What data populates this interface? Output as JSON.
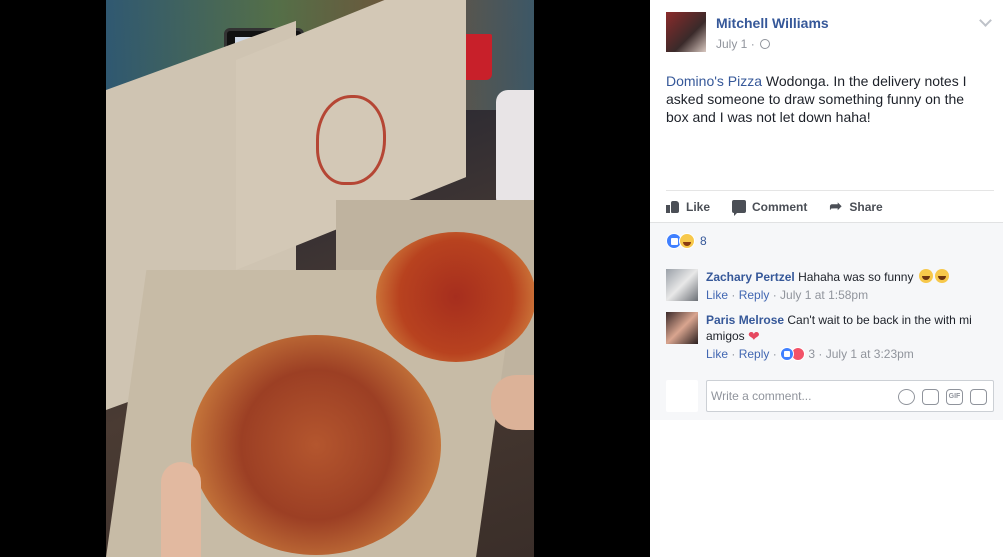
{
  "post": {
    "author": "Mitchell Williams",
    "date": "July 1",
    "separator": "·",
    "text_link": "Domino's Pizza",
    "text_body": " Wodonga. In the delivery notes I asked someone to draw something funny on the box and I was not let down haha!"
  },
  "actions": {
    "like": "Like",
    "comment": "Comment",
    "share": "Share"
  },
  "reactions": {
    "count": "8",
    "types": [
      "like",
      "haha"
    ]
  },
  "comments": [
    {
      "name": "Zachary Pertzel",
      "text": "Hahaha was so funny",
      "emojis": [
        "haha",
        "haha"
      ],
      "like": "Like",
      "reply": "Reply",
      "time": "July 1 at 1:58pm"
    },
    {
      "name": "Paris Melrose",
      "text": "Can't wait to be back in the with mi amigos",
      "emojis": [
        "heart"
      ],
      "like": "Like",
      "reply": "Reply",
      "reaction_count": "3",
      "time": "July 1 at 3:23pm"
    }
  ],
  "composer": {
    "placeholder": "Write a comment...",
    "tools": [
      "emoji-icon",
      "camera-icon",
      "gif-icon",
      "sticker-icon"
    ],
    "gif_label": "GIF"
  },
  "colors": {
    "link": "#365899",
    "like_blue": "#4080ff",
    "muted": "#90949c"
  }
}
